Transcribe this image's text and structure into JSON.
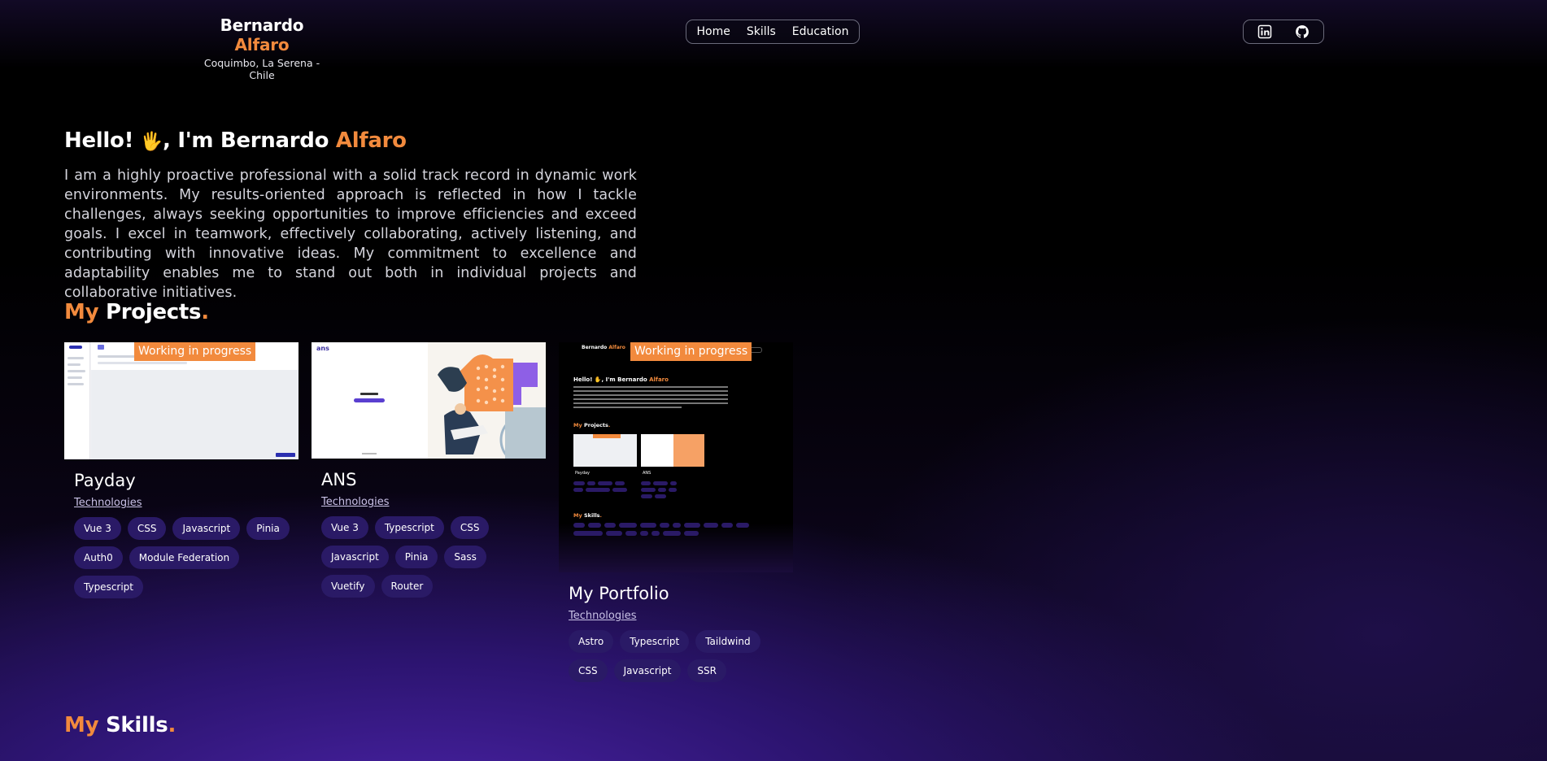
{
  "header": {
    "first_name": "Bernardo",
    "last_name": "Alfaro",
    "location": "Coquimbo, La Serena - Chile"
  },
  "nav": {
    "items": [
      {
        "label": "Home"
      },
      {
        "label": "Skills"
      },
      {
        "label": "Education"
      }
    ]
  },
  "social": {
    "icons": [
      "linkedin-icon",
      "github-icon"
    ]
  },
  "hero": {
    "greeting": "Hello!",
    "emoji": "🖐",
    "intro": ", I'm Bernardo ",
    "highlight": "Alfaro",
    "description": "I am a highly proactive professional with a solid track record in dynamic work environments. My results-oriented approach is reflected in how I tackle challenges, always seeking opportunities to improve efficiencies and exceed goals. I excel in teamwork, effectively collaborating, actively listening, and contributing with innovative ideas. My commitment to excellence and adaptability enables me to stand out both in individual projects and collaborative initiatives."
  },
  "projects_section": {
    "my": "My",
    "title": "Projects",
    "dot": "."
  },
  "skills_section": {
    "my": "My",
    "title": "Skills",
    "dot": "."
  },
  "projects": [
    {
      "title": "Payday",
      "technologies_label": "Technologies",
      "badge": "Working in progress",
      "chips": [
        "Vue 3",
        "CSS",
        "Javascript",
        "Pinia",
        "Auth0",
        "Module Federation",
        "Typescript"
      ]
    },
    {
      "title": "ANS",
      "technologies_label": "Technologies",
      "badge": "",
      "chips": [
        "Vue 3",
        "Typescript",
        "CSS",
        "Javascript",
        "Pinia",
        "Sass",
        "Vuetify",
        "Router"
      ]
    },
    {
      "title": "My Portfolio",
      "technologies_label": "Technologies",
      "badge": "Working in progress",
      "chips": [
        "Astro",
        "Typescript",
        "Taildwind",
        "CSS",
        "Javascript",
        "SSR"
      ]
    }
  ],
  "colors": {
    "accent": "#f28a3d",
    "chip_bg": "#2a1a66",
    "background_top": "#000000",
    "background_glow": "#4b23a8"
  }
}
